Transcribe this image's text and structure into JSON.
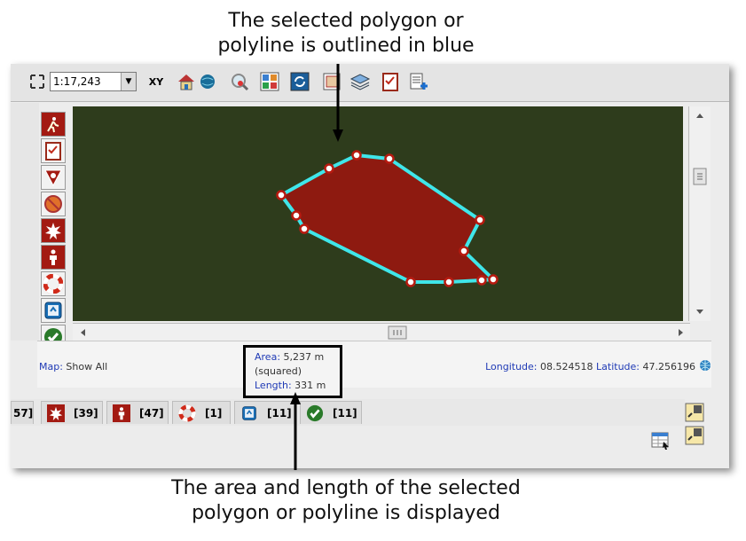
{
  "callouts": {
    "top_line1": "The selected polygon or",
    "top_line2": "polyline is outlined in blue",
    "bottom_line1": "The area and length of the selected",
    "bottom_line2": "polygon or polyline is displayed"
  },
  "toolbar": {
    "scale_value": "1:17,243",
    "xy_label": "XY",
    "icons": [
      "zoom-extent-icon",
      "home-icon",
      "globe-icon",
      "magnifier-icon",
      "grid-layers-icon",
      "refresh-map-icon",
      "layout-icon",
      "stack-layers-icon",
      "checklist-icon",
      "add-document-icon"
    ]
  },
  "palette": {
    "icons": [
      "hiker-icon",
      "checklist-icon",
      "danger-icon",
      "blocked-icon",
      "explosion-icon",
      "person-icon",
      "lifebuoy-icon",
      "certificate-icon",
      "checkmark-icon"
    ]
  },
  "status": {
    "map_label": "Map:",
    "map_value": "Show All",
    "area_label": "Area:",
    "area_value": "5,237 m",
    "area_unit": "(squared)",
    "length_label": "Length:",
    "length_value": "331 m",
    "longitude_label": "Longitude:",
    "longitude_value": "08.524518",
    "latitude_label": "Latitude:",
    "latitude_value": "47.256196"
  },
  "tabs": [
    {
      "count": "57]",
      "icon": ""
    },
    {
      "count": "[39]",
      "icon": "explosion-icon"
    },
    {
      "count": "[47]",
      "icon": "person-icon"
    },
    {
      "count": "[1]",
      "icon": "lifebuoy-icon"
    },
    {
      "count": "[11]",
      "icon": "certificate-icon"
    },
    {
      "count": "[11]",
      "icon": "checkmark-icon"
    }
  ],
  "colors": {
    "map_background": "#2e3c1c",
    "polygon_fill": "#8e1a10",
    "selection_outline": "#3fe6ea",
    "label_blue": "#1f3ab5"
  }
}
